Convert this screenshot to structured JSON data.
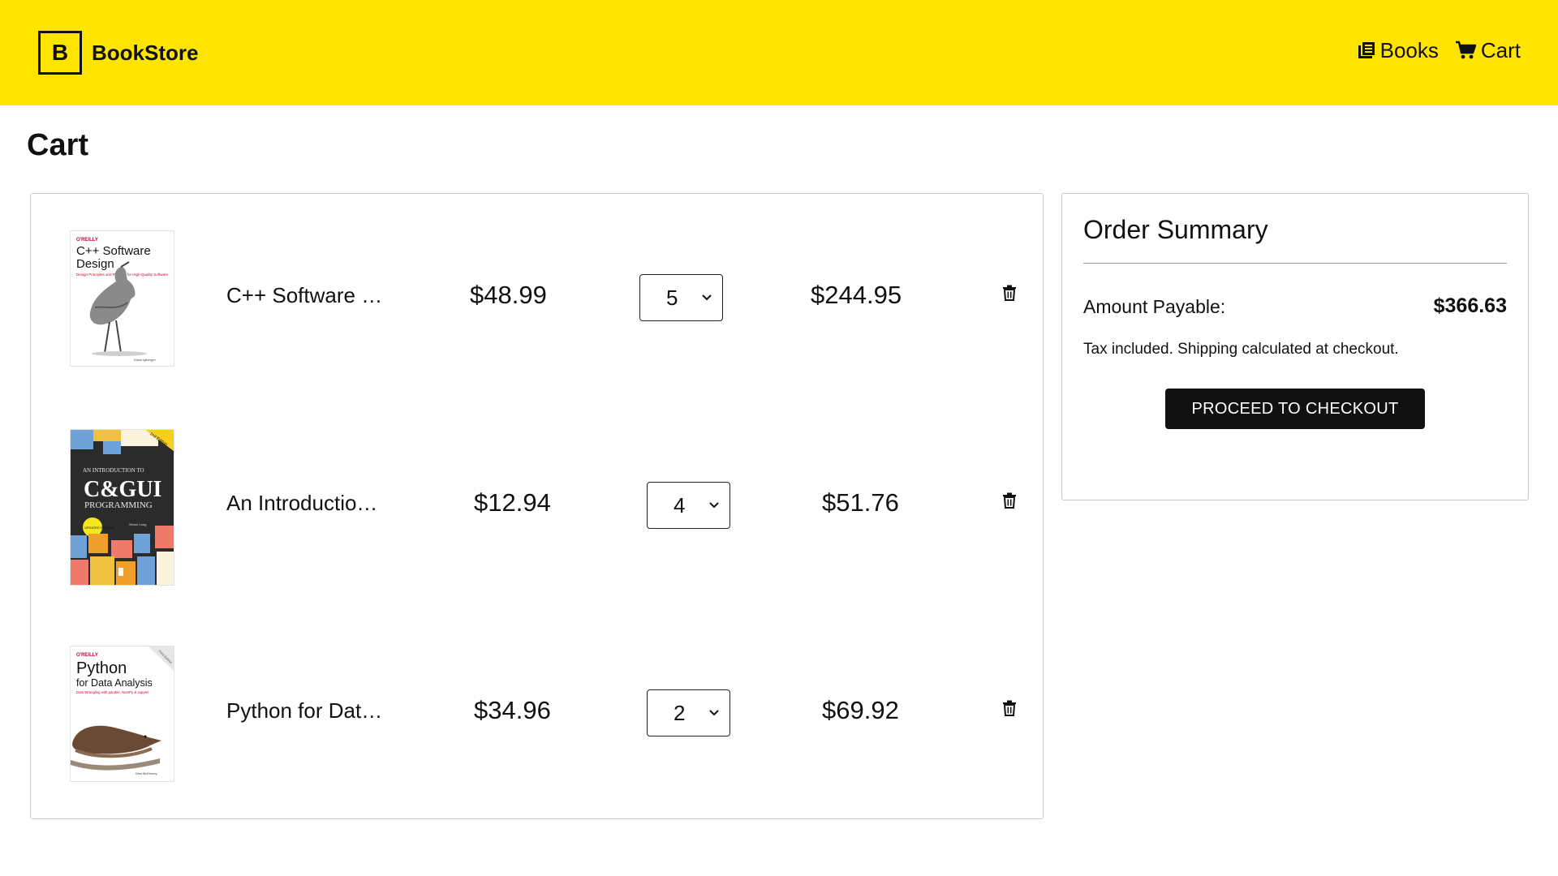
{
  "brand": {
    "logo_letter": "B",
    "name": "BookStore"
  },
  "nav": {
    "books_label": "Books",
    "books_icon": "books-icon",
    "cart_label": "Cart",
    "cart_icon": "cart-icon"
  },
  "page": {
    "title": "Cart"
  },
  "cart": {
    "items": [
      {
        "title": "C++ Software …",
        "cover_icon": "book-cover-cpp-software-design",
        "price": "$48.99",
        "quantity": "5",
        "total": "$244.95",
        "remove_icon": "trash-icon"
      },
      {
        "title": "An Introductio…",
        "cover_icon": "book-cover-intro-cpp-gui",
        "price": "$12.94",
        "quantity": "4",
        "total": "$51.76",
        "remove_icon": "trash-icon"
      },
      {
        "title": "Python for Dat…",
        "cover_icon": "book-cover-python-data-analysis",
        "price": "$34.96",
        "quantity": "2",
        "total": "$69.92",
        "remove_icon": "trash-icon"
      }
    ]
  },
  "covers": {
    "cpp": {
      "publisher": "O'REILLY",
      "title_line1": "C++ Software",
      "title_line2": "Design",
      "subtitle": "Design Principles and Patterns for High-Quality Software",
      "author": "Klaus Iglberger"
    },
    "gui": {
      "line1": "AN INTRODUCTION TO",
      "line2": "C&GUI",
      "line3": "PROGRAMMING",
      "badge": "2nd Edition",
      "author": "Simon Long",
      "sticker": "UPDATED FOR 2ND"
    },
    "python": {
      "publisher": "O'REILLY",
      "title_line1": "Python",
      "title_line2": "for Data Analysis",
      "subtitle": "Data Wrangling with pandas, NumPy & Jupyter",
      "author": "Wes McKinney",
      "badge": "Third Edition"
    }
  },
  "summary": {
    "title": "Order Summary",
    "amount_label": "Amount Payable:",
    "amount_value": "$366.63",
    "tax_note": "Tax included. Shipping calculated at checkout.",
    "checkout_label": "PROCEED TO CHECKOUT"
  },
  "colors": {
    "header_bg": "#ffe400",
    "button_bg": "#111111"
  }
}
